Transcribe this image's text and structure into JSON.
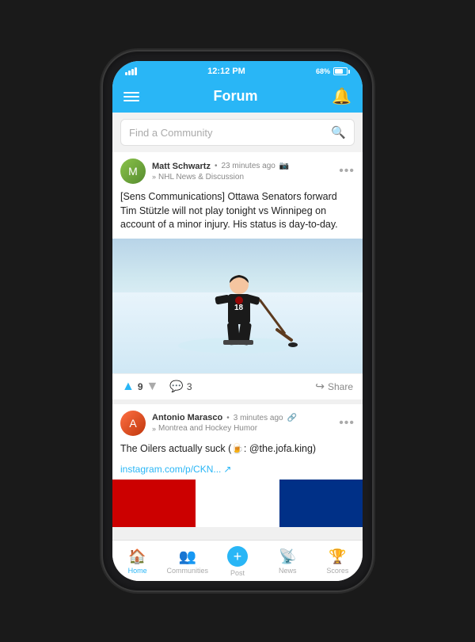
{
  "status_bar": {
    "time": "12:12 PM",
    "battery_pct": "68%"
  },
  "top_nav": {
    "title": "Forum",
    "hamburger_label": "menu",
    "bell_label": "notifications"
  },
  "search": {
    "placeholder": "Find a Community"
  },
  "post1": {
    "author": "Matt Schwartz",
    "time": "23 minutes ago",
    "community": "NHL News & Discussion",
    "text": "[Sens Communications] Ottawa Senators forward Tim Stützle will not play tonight vs Winnipeg on account of a minor injury. His status is day-to-day.",
    "votes": "9",
    "comments": "3",
    "share": "Share"
  },
  "post2": {
    "author": "Antonio Marasco",
    "time": "3 minutes ago",
    "community": "Montrea and Hockey Humor",
    "text": "The Oilers actually suck (🍺: @the.jofa.king)",
    "link": "instagram.com/p/CKN...",
    "link_icon": "↗"
  },
  "bottom_nav": {
    "items": [
      {
        "label": "Home",
        "icon": "🏠",
        "active": true
      },
      {
        "label": "Communities",
        "icon": "👥",
        "active": false
      },
      {
        "label": "Post",
        "icon": "+",
        "active": false
      },
      {
        "label": "News",
        "icon": "📶",
        "active": false
      },
      {
        "label": "Scores",
        "icon": "🏆",
        "active": false
      }
    ]
  }
}
